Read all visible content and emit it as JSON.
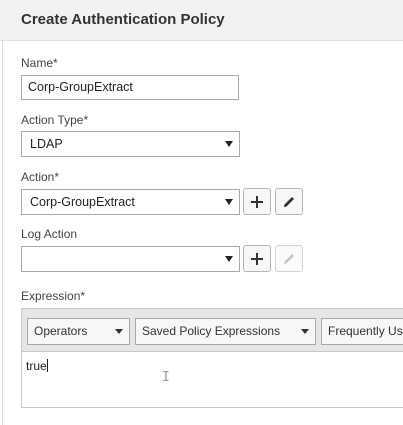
{
  "header": {
    "title": "Create Authentication Policy"
  },
  "form": {
    "name": {
      "label": "Name*",
      "value": "Corp-GroupExtract"
    },
    "action_type": {
      "label": "Action Type*",
      "value": "LDAP"
    },
    "action": {
      "label": "Action*",
      "value": "Corp-GroupExtract"
    },
    "log_action": {
      "label": "Log Action",
      "value": ""
    },
    "expression": {
      "label": "Expression*",
      "toolbar": {
        "operators": "Operators",
        "saved": "Saved Policy Expressions",
        "frequent": "Frequently Used Expressions"
      },
      "value": "true"
    }
  },
  "icons": {
    "add": "plus-icon",
    "edit": "pencil-icon"
  }
}
